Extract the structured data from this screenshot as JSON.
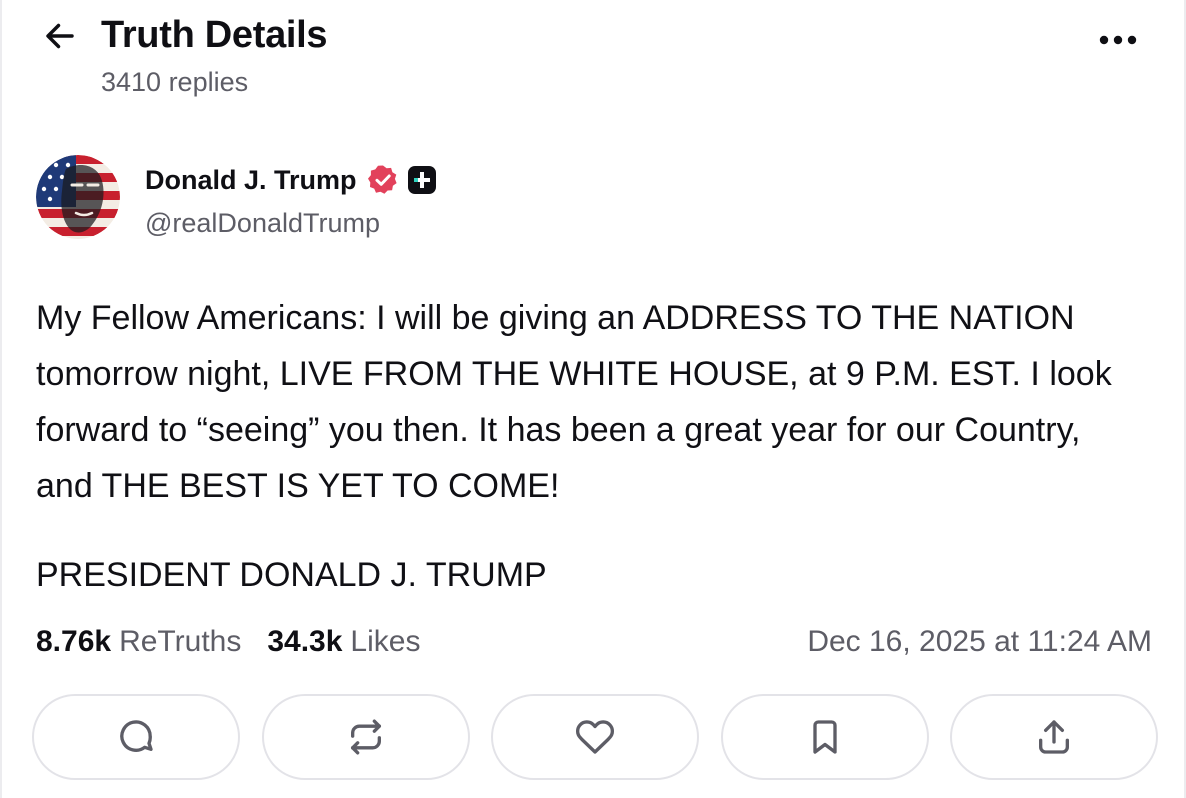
{
  "header": {
    "back_icon": "arrow-left-icon",
    "title": "Truth Details",
    "replies_count": "3410 replies",
    "more_icon": "more-horizontal-icon"
  },
  "author": {
    "avatar_icon": "avatar",
    "name": "Donald J. Trump",
    "verified_icon": "verified-badge-icon",
    "plus_icon": "truth-plus-badge-icon",
    "handle": "@realDonaldTrump"
  },
  "post": {
    "text": "My Fellow Americans: I will be giving an ADDRESS TO THE NATION tomorrow night, LIVE FROM THE WHITE HOUSE, at 9 P.M. EST. I look forward to “seeing” you then. It has been a great year for our Country, and THE BEST IS YET TO COME!",
    "signature": "PRESIDENT DONALD J. TRUMP"
  },
  "stats": {
    "retruths_count": "8.76k",
    "retruths_label": "ReTruths",
    "likes_count": "34.3k",
    "likes_label": "Likes",
    "timestamp": "Dec 16, 2025 at 11:24 AM"
  },
  "actions": [
    {
      "icon": "reply-icon"
    },
    {
      "icon": "retruth-icon"
    },
    {
      "icon": "heart-icon"
    },
    {
      "icon": "bookmark-icon"
    },
    {
      "icon": "share-icon"
    }
  ],
  "colors": {
    "text_primary": "#0f0f14",
    "text_secondary": "#5d5d66",
    "verified_badge": "#e2415b",
    "button_border": "#e3e3e8",
    "accent_blue": "#1f3a78",
    "accent_red": "#c8202e"
  }
}
